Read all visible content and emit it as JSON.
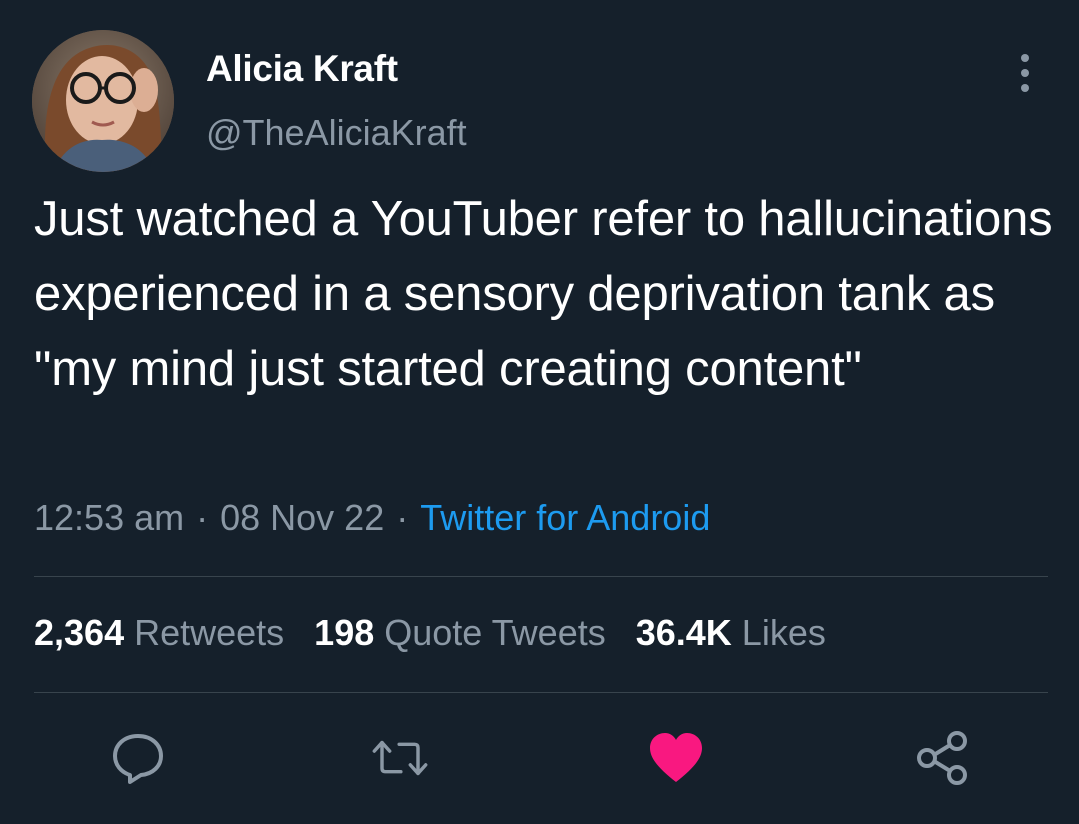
{
  "author": {
    "name": "Alicia Kraft",
    "handle": "@TheAliciaKraft"
  },
  "tweet": {
    "text": "Just watched a YouTuber refer to hallucinations experienced in a sensory deprivation tank as \"my mind just started creating content\"",
    "time": "12:53 am",
    "date": "08 Nov 22",
    "separator": "·",
    "source": "Twitter for Android"
  },
  "stats": {
    "retweets": {
      "count": "2,364",
      "label": "Retweets"
    },
    "quotes": {
      "count": "198",
      "label": "Quote Tweets"
    },
    "likes": {
      "count": "36.4K",
      "label": "Likes"
    }
  },
  "actions": [
    {
      "icon": "reply-icon"
    },
    {
      "icon": "retweet-icon"
    },
    {
      "icon": "like-icon",
      "state": "liked"
    },
    {
      "icon": "share-icon"
    }
  ],
  "colors": {
    "background": "#15202b",
    "secondary_text": "#8b98a5",
    "link": "#1d9bf0",
    "like": "#f91880",
    "divider": "#38444d"
  }
}
